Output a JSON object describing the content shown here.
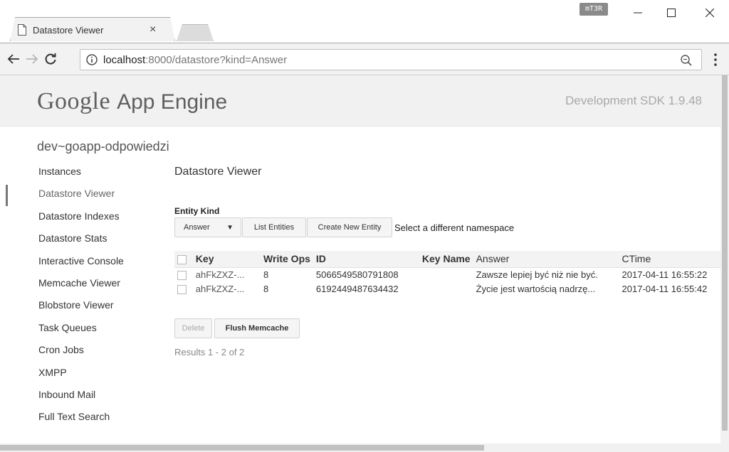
{
  "browser": {
    "tab_title": "Datastore Viewer",
    "tab_close": "×",
    "extension_badge": "mT3R",
    "url_host": "localhost",
    "url_path": ":8000/datastore?kind=Answer"
  },
  "header": {
    "logo_google": "Google",
    "logo_app_engine": "App Engine",
    "sdk_version": "Development SDK 1.9.48"
  },
  "app_id": "dev~goapp-odpowiedzi",
  "sidebar": {
    "items": [
      {
        "label": "Instances"
      },
      {
        "label": "Datastore Viewer"
      },
      {
        "label": "Datastore Indexes"
      },
      {
        "label": "Datastore Stats"
      },
      {
        "label": "Interactive Console"
      },
      {
        "label": "Memcache Viewer"
      },
      {
        "label": "Blobstore Viewer"
      },
      {
        "label": "Task Queues"
      },
      {
        "label": "Cron Jobs"
      },
      {
        "label": "XMPP"
      },
      {
        "label": "Inbound Mail"
      },
      {
        "label": "Full Text Search"
      }
    ]
  },
  "main": {
    "title": "Datastore Viewer",
    "entity_kind_label": "Entity Kind",
    "kind_select_value": "Answer",
    "list_entities_label": "List Entities",
    "create_entity_label": "Create New Entity",
    "namespace_link": "Select a different namespace",
    "table": {
      "headers": {
        "key": "Key",
        "write_ops": "Write Ops",
        "id": "ID",
        "key_name": "Key Name",
        "answer": "Answer",
        "ctime": "CTime"
      },
      "rows": [
        {
          "key": "ahFkZXZ-...",
          "write_ops": "8",
          "id": "5066549580791808",
          "key_name": "",
          "answer": "Zawsze lepiej być niż nie być.",
          "ctime": "2017-04-11 16:55:22"
        },
        {
          "key": "ahFkZXZ-...",
          "write_ops": "8",
          "id": "6192449487634432",
          "key_name": "",
          "answer": "Życie jest wartością nadrzę...",
          "ctime": "2017-04-11 16:55:42"
        }
      ]
    },
    "delete_label": "Delete",
    "flush_label": "Flush Memcache",
    "results_text": "Results 1 - 2 of 2"
  }
}
